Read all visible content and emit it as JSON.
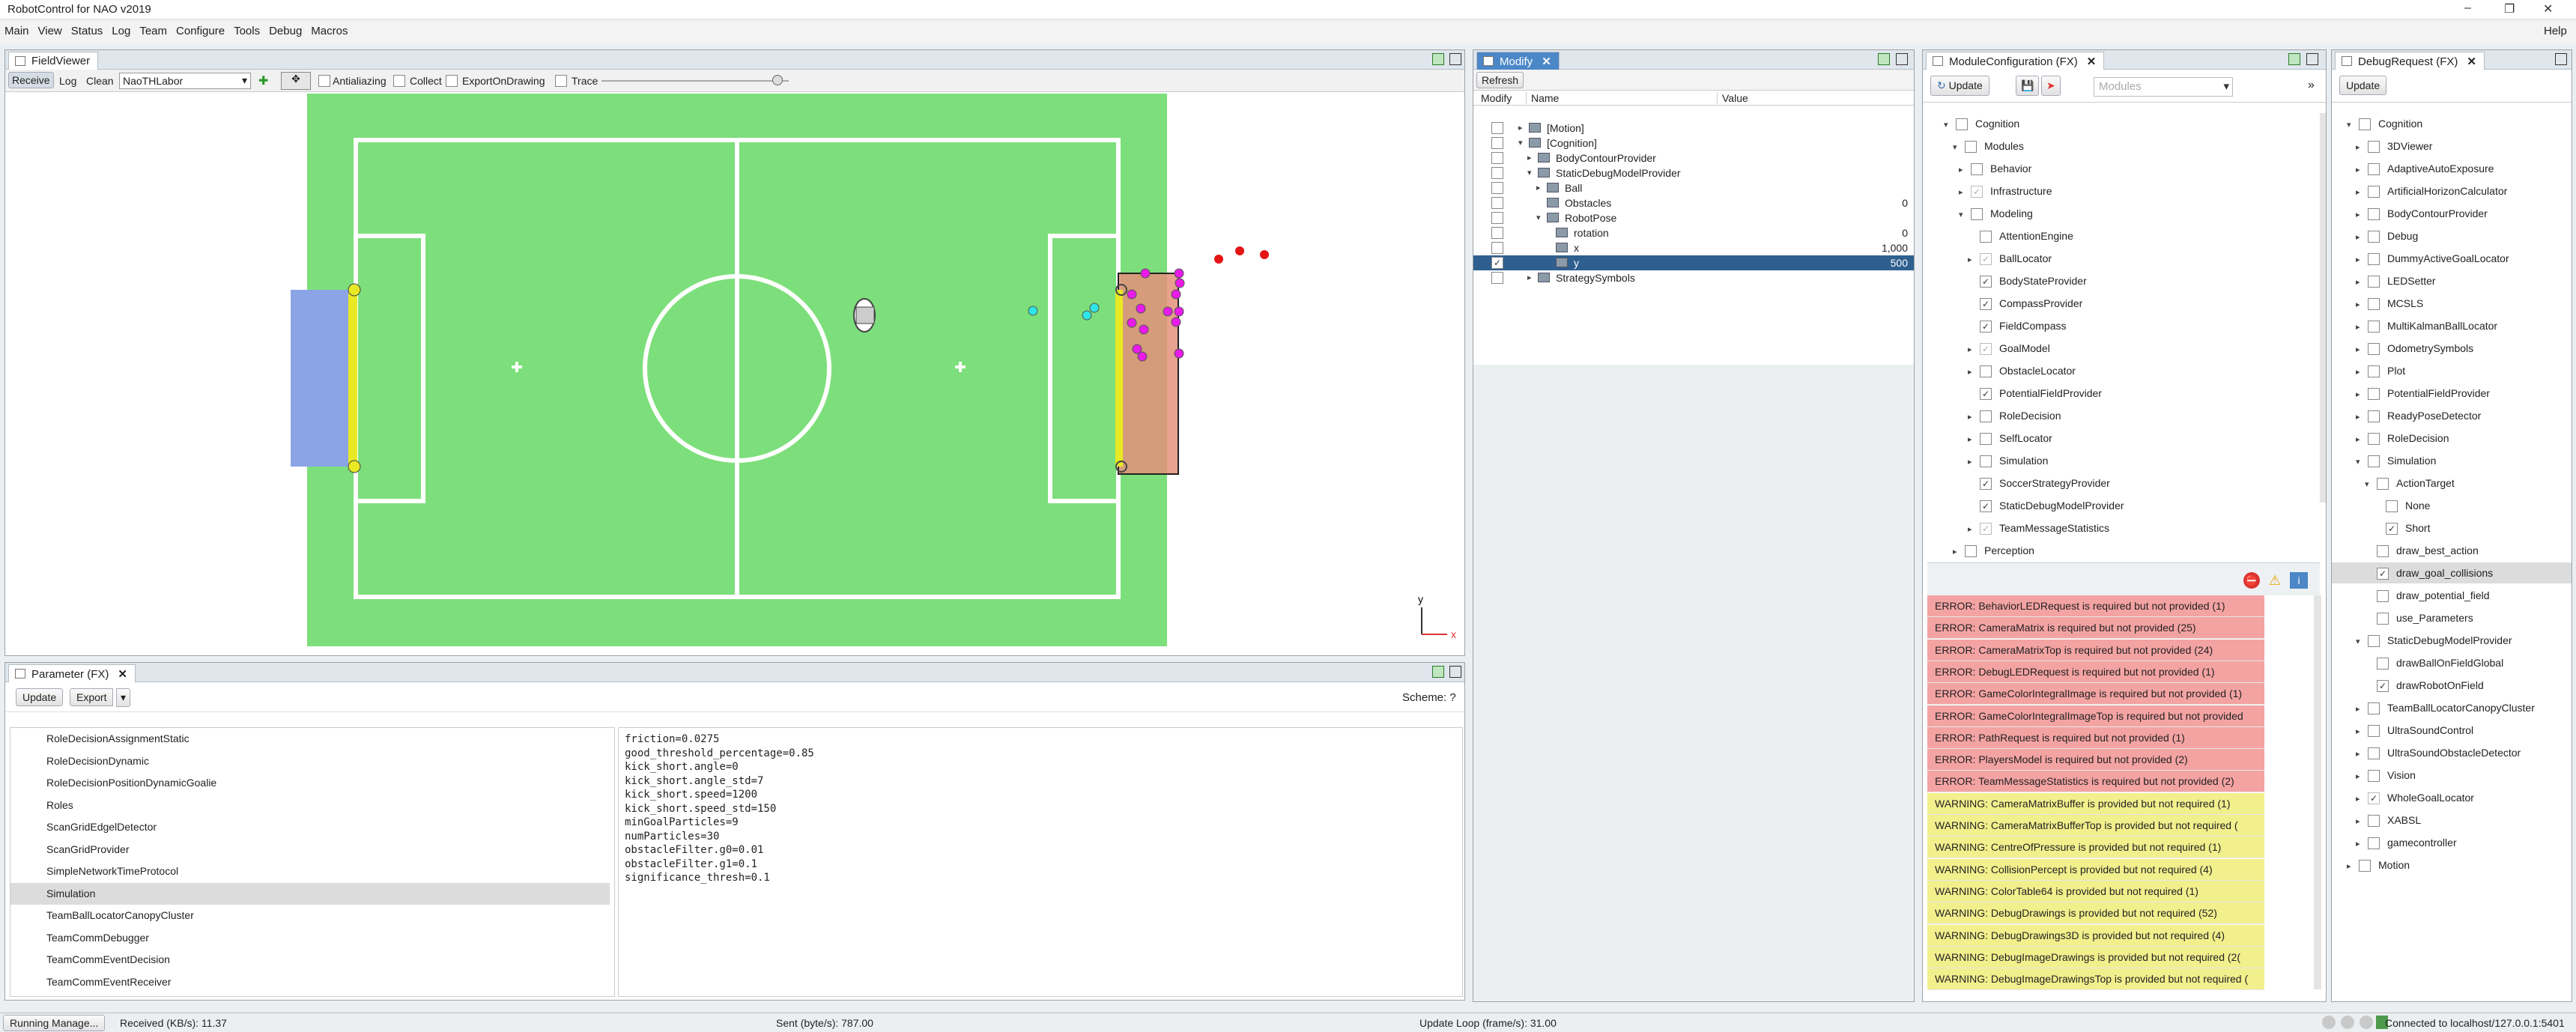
{
  "app": {
    "title": "RobotControl for NAO v2019",
    "help": "Help"
  },
  "menu": [
    "Main",
    "View",
    "Status",
    "Log",
    "Team",
    "Configure",
    "Tools",
    "Debug",
    "Macros"
  ],
  "fieldviewer": {
    "tab": "FieldViewer",
    "toolbar": {
      "receive": "Receive",
      "log": "Log",
      "clean": "Clean",
      "select_value": "NaoTHLabor",
      "antialiazing": "Antialiazing",
      "collect": "Collect",
      "export": "ExportOnDrawing",
      "trace": "Trace"
    },
    "axis_y": "y",
    "axis_x": "x"
  },
  "parameter": {
    "tab": "Parameter (FX)",
    "update": "Update",
    "export": "Export",
    "scheme": "Scheme: ?",
    "list": [
      "RoleDecisionAssignmentStatic",
      "RoleDecisionDynamic",
      "RoleDecisionPositionDynamicGoalie",
      "Roles",
      "ScanGridEdgelDetector",
      "ScanGridProvider",
      "SimpleNetworkTimeProtocol",
      "Simulation",
      "TeamBallLocatorCanopyCluster",
      "TeamCommDebugger",
      "TeamCommEventDecision",
      "TeamCommEventReceiver"
    ],
    "selected": "Simulation",
    "params": [
      "friction=0.0275",
      "good_threshold_percentage=0.85",
      "kick_short.angle=0",
      "kick_short.angle_std=7",
      "kick_short.speed=1200",
      "kick_short.speed_std=150",
      "minGoalParticles=9",
      "numParticles=30",
      "obstacleFilter.g0=0.01",
      "obstacleFilter.g1=0.1",
      "significance_thresh=0.1"
    ]
  },
  "modify": {
    "tab": "Modify",
    "refresh": "Refresh",
    "headers": {
      "modify": "Modify",
      "name": "Name",
      "value": "Value"
    },
    "rows": [
      {
        "name": "[Motion]",
        "value": ""
      },
      {
        "name": "[Cognition]",
        "value": ""
      },
      {
        "name": "BodyContourProvider",
        "value": ""
      },
      {
        "name": "StaticDebugModelProvider",
        "value": ""
      },
      {
        "name": "Ball",
        "value": ""
      },
      {
        "name": "Obstacles",
        "value": "0"
      },
      {
        "name": "RobotPose",
        "value": ""
      },
      {
        "name": "rotation",
        "value": "0"
      },
      {
        "name": "x",
        "value": "1,000"
      },
      {
        "name": "y",
        "value": "500"
      },
      {
        "name": "StrategySymbols",
        "value": ""
      }
    ]
  },
  "moduleconfig": {
    "tab": "ModuleConfiguration (FX)",
    "update": "Update",
    "search_placeholder": "Modules",
    "tree": [
      "Cognition",
      "Modules",
      "Behavior",
      "Infrastructure",
      "Modeling",
      "AttentionEngine",
      "BallLocator",
      "BodyStateProvider",
      "CompassProvider",
      "FieldCompass",
      "GoalModel",
      "ObstacleLocator",
      "PotentialFieldProvider",
      "RoleDecision",
      "SelfLocator",
      "Simulation",
      "SoccerStrategyProvider",
      "StaticDebugModelProvider",
      "TeamMessageStatistics",
      "Perception"
    ],
    "messages": [
      {
        "t": "err",
        "text": "ERROR: BehaviorLEDRequest is required but not provided (1)"
      },
      {
        "t": "err",
        "text": "ERROR: CameraMatrix is required but not provided (25)"
      },
      {
        "t": "err",
        "text": "ERROR: CameraMatrixTop is required but not provided (24)"
      },
      {
        "t": "err",
        "text": "ERROR: DebugLEDRequest is required but not provided (1)"
      },
      {
        "t": "err",
        "text": "ERROR: GameColorIntegralImage is required but not provided (1)"
      },
      {
        "t": "err",
        "text": "ERROR: GameColorIntegralImageTop is required but not provided"
      },
      {
        "t": "err",
        "text": "ERROR: PathRequest is required but not provided (1)"
      },
      {
        "t": "err",
        "text": "ERROR: PlayersModel is required but not provided (2)"
      },
      {
        "t": "err",
        "text": "ERROR: TeamMessageStatistics is required but not provided (2)"
      },
      {
        "t": "warn",
        "text": "WARNING: CameraMatrixBuffer is provided but not required (1)"
      },
      {
        "t": "warn",
        "text": "WARNING: CameraMatrixBufferTop is provided but not required ("
      },
      {
        "t": "warn",
        "text": "WARNING: CentreOfPressure is provided but not required (1)"
      },
      {
        "t": "warn",
        "text": "WARNING: CollisionPercept is provided but not required (4)"
      },
      {
        "t": "warn",
        "text": "WARNING: ColorTable64 is provided but not required (1)"
      },
      {
        "t": "warn",
        "text": "WARNING: DebugDrawings is provided but not required (52)"
      },
      {
        "t": "warn",
        "text": "WARNING: DebugDrawings3D is provided but not required (4)"
      },
      {
        "t": "warn",
        "text": "WARNING: DebugImageDrawings is provided but not required (2("
      },
      {
        "t": "warn",
        "text": "WARNING: DebugImageDrawingsTop is provided but not required ("
      }
    ]
  },
  "debugrequest": {
    "tab": "DebugRequest (FX)",
    "update": "Update",
    "tree": [
      "Cognition",
      "3DViewer",
      "AdaptiveAutoExposure",
      "ArtificialHorizonCalculator",
      "BodyContourProvider",
      "Debug",
      "DummyActiveGoalLocator",
      "LEDSetter",
      "MCSLS",
      "MultiKalmanBallLocator",
      "OdometrySymbols",
      "Plot",
      "PotentialFieldProvider",
      "ReadyPoseDetector",
      "RoleDecision",
      "Simulation",
      "ActionTarget",
      "None",
      "Short",
      "draw_best_action",
      "draw_goal_collisions",
      "draw_potential_field",
      "use_Parameters",
      "StaticDebugModelProvider",
      "drawBallOnFieldGlobal",
      "drawRobotOnField",
      "TeamBallLocatorCanopyCluster",
      "UltraSoundControl",
      "UltraSoundObstacleDetector",
      "Vision",
      "WholeGoalLocator",
      "XABSL",
      "gamecontroller",
      "Motion"
    ]
  },
  "status": {
    "running": "Running Manage...",
    "received": "Received (KB/s): 11.37",
    "sent": "Sent (byte/s): 787.00",
    "update_loop": "Update Loop (frame/s): 31.00",
    "connected": "Connected to localhost/127.0.0.1:5401"
  },
  "colors": {
    "field": "#7ddf7b",
    "accent": "#4c87c7",
    "error": "#f4a3a3",
    "warning": "#f2ef8d"
  }
}
